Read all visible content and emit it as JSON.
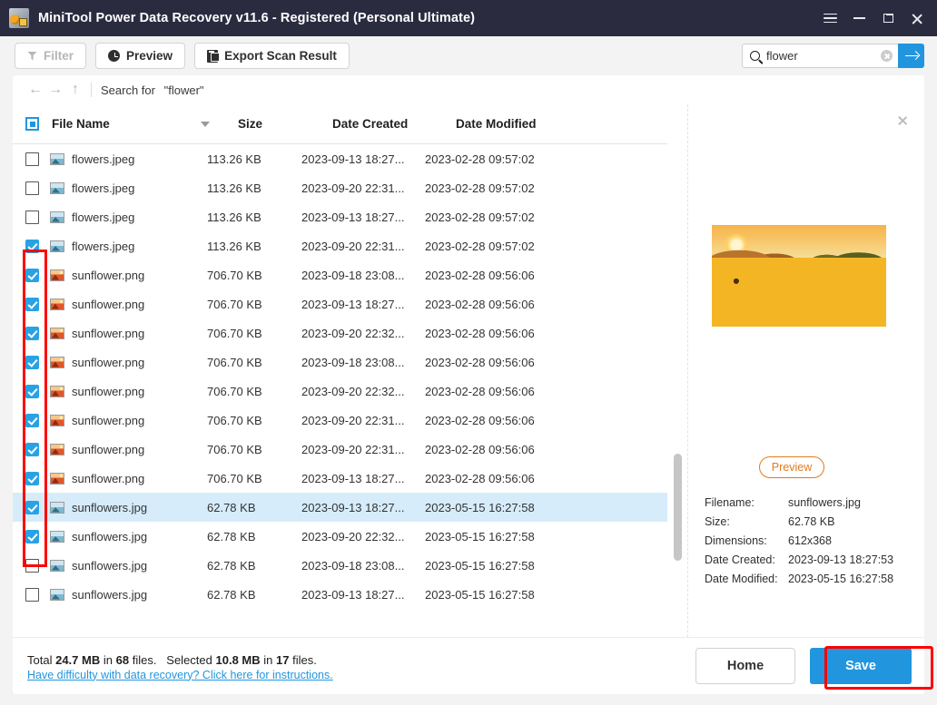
{
  "window": {
    "title": "MiniTool Power Data Recovery v11.6 - Registered (Personal Ultimate)",
    "app_icon": "minitool-logo-icon",
    "controls": {
      "menu": "menu-icon",
      "minimize": "minimize-icon",
      "restore": "restore-icon",
      "close": "close-icon"
    },
    "titlebar_color": "#2b2b40",
    "accent_color": "#2196de"
  },
  "toolbar": {
    "filter_label": "Filter",
    "filter_disabled": true,
    "preview_label": "Preview",
    "export_label": "Export Scan Result",
    "search": {
      "value": "flower",
      "placeholder": "Search",
      "search_icon": "search-icon",
      "clear_icon": "clear-circle-icon",
      "go_icon": "arrow-right-icon"
    }
  },
  "navbar": {
    "back": "←",
    "forward": "→",
    "up": "↑",
    "crumb_prefix": "Search for",
    "crumb_query": "\"flower\""
  },
  "table": {
    "select_all_state": "indeterminate",
    "sort_column": "File Name",
    "sort_direction": "desc",
    "columns": [
      "File Name",
      "Size",
      "Date Created",
      "Date Modified"
    ],
    "rows": [
      {
        "checked": false,
        "icon": "jpeg",
        "name": "flowers.jpeg",
        "size": "113.26 KB",
        "created": "2023-09-13 18:27...",
        "modified": "2023-02-28 09:57:02",
        "selected": false
      },
      {
        "checked": false,
        "icon": "jpeg",
        "name": "flowers.jpeg",
        "size": "113.26 KB",
        "created": "2023-09-20 22:31...",
        "modified": "2023-02-28 09:57:02",
        "selected": false
      },
      {
        "checked": false,
        "icon": "jpeg",
        "name": "flowers.jpeg",
        "size": "113.26 KB",
        "created": "2023-09-13 18:27...",
        "modified": "2023-02-28 09:57:02",
        "selected": false
      },
      {
        "checked": true,
        "icon": "jpeg",
        "name": "flowers.jpeg",
        "size": "113.26 KB",
        "created": "2023-09-20 22:31...",
        "modified": "2023-02-28 09:57:02",
        "selected": false
      },
      {
        "checked": true,
        "icon": "png",
        "name": "sunflower.png",
        "size": "706.70 KB",
        "created": "2023-09-18 23:08...",
        "modified": "2023-02-28 09:56:06",
        "selected": false
      },
      {
        "checked": true,
        "icon": "png",
        "name": "sunflower.png",
        "size": "706.70 KB",
        "created": "2023-09-13 18:27...",
        "modified": "2023-02-28 09:56:06",
        "selected": false
      },
      {
        "checked": true,
        "icon": "png",
        "name": "sunflower.png",
        "size": "706.70 KB",
        "created": "2023-09-20 22:32...",
        "modified": "2023-02-28 09:56:06",
        "selected": false
      },
      {
        "checked": true,
        "icon": "png",
        "name": "sunflower.png",
        "size": "706.70 KB",
        "created": "2023-09-18 23:08...",
        "modified": "2023-02-28 09:56:06",
        "selected": false
      },
      {
        "checked": true,
        "icon": "png",
        "name": "sunflower.png",
        "size": "706.70 KB",
        "created": "2023-09-20 22:32...",
        "modified": "2023-02-28 09:56:06",
        "selected": false
      },
      {
        "checked": true,
        "icon": "png",
        "name": "sunflower.png",
        "size": "706.70 KB",
        "created": "2023-09-20 22:31...",
        "modified": "2023-02-28 09:56:06",
        "selected": false
      },
      {
        "checked": true,
        "icon": "png",
        "name": "sunflower.png",
        "size": "706.70 KB",
        "created": "2023-09-20 22:31...",
        "modified": "2023-02-28 09:56:06",
        "selected": false
      },
      {
        "checked": true,
        "icon": "png",
        "name": "sunflower.png",
        "size": "706.70 KB",
        "created": "2023-09-13 18:27...",
        "modified": "2023-02-28 09:56:06",
        "selected": false
      },
      {
        "checked": true,
        "icon": "jpeg",
        "name": "sunflowers.jpg",
        "size": "62.78 KB",
        "created": "2023-09-13 18:27...",
        "modified": "2023-05-15 16:27:58",
        "selected": true
      },
      {
        "checked": true,
        "icon": "jpeg",
        "name": "sunflowers.jpg",
        "size": "62.78 KB",
        "created": "2023-09-20 22:32...",
        "modified": "2023-05-15 16:27:58",
        "selected": false
      },
      {
        "checked": false,
        "icon": "jpeg",
        "name": "sunflowers.jpg",
        "size": "62.78 KB",
        "created": "2023-09-18 23:08...",
        "modified": "2023-05-15 16:27:58",
        "selected": false
      },
      {
        "checked": false,
        "icon": "jpeg",
        "name": "sunflowers.jpg",
        "size": "62.78 KB",
        "created": "2023-09-13 18:27...",
        "modified": "2023-05-15 16:27:58",
        "selected": false
      }
    ]
  },
  "preview": {
    "close_icon": "close-icon",
    "image_alt": "sunflower-field-photo",
    "preview_button": "Preview",
    "fields": [
      {
        "key": "Filename:",
        "value": "sunflowers.jpg"
      },
      {
        "key": "Size:",
        "value": "62.78 KB"
      },
      {
        "key": "Dimensions:",
        "value": "612x368"
      },
      {
        "key": "Date Created:",
        "value": "2023-09-13 18:27:53"
      },
      {
        "key": "Date Modified:",
        "value": "2023-05-15 16:27:58"
      }
    ]
  },
  "footer": {
    "total_prefix": "Total",
    "total_size": "24.7 MB",
    "total_mid": "in",
    "total_count": "68",
    "total_files": "files.",
    "selected_prefix": "Selected",
    "selected_size": "10.8 MB",
    "selected_mid": "in",
    "selected_count": "17",
    "selected_files": "files.",
    "help_link": "Have difficulty with data recovery? Click here for instructions.",
    "home_label": "Home",
    "save_label": "Save"
  },
  "annotations": {
    "checkbox_highlight": "#ff0000",
    "save_highlight": "#ff0000"
  }
}
